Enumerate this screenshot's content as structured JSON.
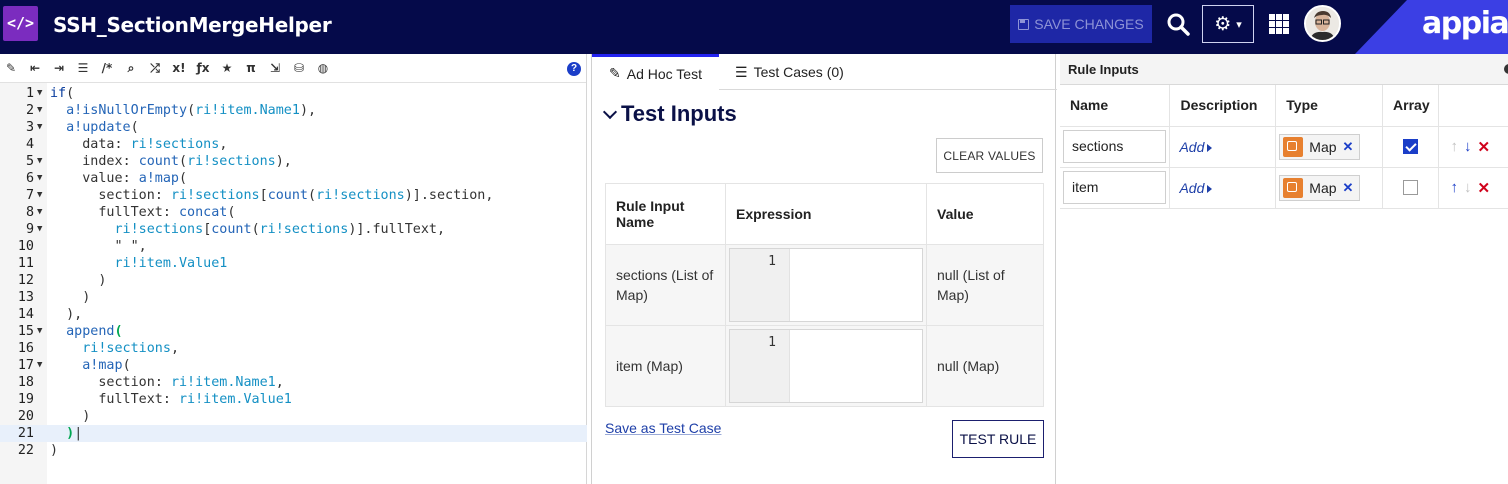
{
  "header": {
    "app_title": "SSH_SectionMergeHelper",
    "save_label": "SAVE CHANGES",
    "logo_text": "appian",
    "app_icon_glyph": "</>",
    "icons": [
      "code-icon",
      "save-icon",
      "search-icon",
      "gear-icon",
      "chevron-down-icon",
      "grid-icon",
      "avatar"
    ]
  },
  "editor": {
    "toolbar_icons": [
      "magic-wand-icon",
      "outdent-icon",
      "indent-icon",
      "list-icon",
      "comment-icon",
      "search-icon",
      "shuffle-icon",
      "x-bang-icon",
      "fx-icon",
      "star-icon",
      "pi-icon",
      "exit-icon",
      "database-icon",
      "globe-icon",
      "help-icon"
    ],
    "toolbar_glyphs": [
      "✎",
      "⇤",
      "⇥",
      "☰",
      "/*",
      "⌕",
      "⤮",
      "x!",
      "ƒx",
      "★",
      "π",
      "⇲",
      "⛁",
      "◍"
    ],
    "help_glyph": "?",
    "lines": [
      {
        "n": "1",
        "fold": "▼",
        "html": "<span class='k'>if</span><span class='p'>(</span>"
      },
      {
        "n": "2",
        "fold": "▼",
        "html": "  <span class='f'>a!isNullOrEmpty</span><span class='p'>(</span><span class='v'>ri!item.Name1</span><span class='p'>),</span>"
      },
      {
        "n": "3",
        "fold": "▼",
        "html": "  <span class='f'>a!update</span><span class='p'>(</span>"
      },
      {
        "n": "4",
        "fold": "",
        "html": "    <span class='s'>data</span><span class='p'>: </span><span class='v'>ri!sections</span><span class='p'>,</span>"
      },
      {
        "n": "5",
        "fold": "▼",
        "html": "    <span class='s'>index</span><span class='p'>: </span><span class='f'>count</span><span class='p'>(</span><span class='v'>ri!sections</span><span class='p'>),</span>"
      },
      {
        "n": "6",
        "fold": "▼",
        "html": "    <span class='s'>value</span><span class='p'>: </span><span class='f'>a!map</span><span class='p'>(</span>"
      },
      {
        "n": "7",
        "fold": "▼",
        "html": "      <span class='s'>section</span><span class='p'>: </span><span class='v'>ri!sections</span><span class='p'>[</span><span class='f'>count</span><span class='p'>(</span><span class='v'>ri!sections</span><span class='p'>)].section,</span>"
      },
      {
        "n": "8",
        "fold": "▼",
        "html": "      <span class='s'>fullText</span><span class='p'>: </span><span class='f'>concat</span><span class='p'>(</span>"
      },
      {
        "n": "9",
        "fold": "▼",
        "html": "        <span class='v'>ri!sections</span><span class='p'>[</span><span class='f'>count</span><span class='p'>(</span><span class='v'>ri!sections</span><span class='p'>)].fullText,</span>"
      },
      {
        "n": "10",
        "fold": "",
        "html": "        <span class='p'>\" \",</span>"
      },
      {
        "n": "11",
        "fold": "",
        "html": "        <span class='v'>ri!item.Value1</span>"
      },
      {
        "n": "12",
        "fold": "",
        "html": "      <span class='p'>)</span>"
      },
      {
        "n": "13",
        "fold": "",
        "html": "    <span class='p'>)</span>"
      },
      {
        "n": "14",
        "fold": "",
        "html": "  <span class='p'>),</span>"
      },
      {
        "n": "15",
        "fold": "▼",
        "html": "  <span class='f'>append</span><span class='cursor-bracket'>(</span>"
      },
      {
        "n": "16",
        "fold": "",
        "html": "    <span class='v'>ri!sections</span><span class='p'>,</span>"
      },
      {
        "n": "17",
        "fold": "▼",
        "html": "    <span class='f'>a!map</span><span class='p'>(</span>"
      },
      {
        "n": "18",
        "fold": "",
        "html": "      <span class='s'>section</span><span class='p'>: </span><span class='v'>ri!item.Name1</span><span class='p'>,</span>"
      },
      {
        "n": "19",
        "fold": "",
        "html": "      <span class='s'>fullText</span><span class='p'>: </span><span class='v'>ri!item.Value1</span>"
      },
      {
        "n": "20",
        "fold": "",
        "html": "    <span class='p'>)</span>"
      },
      {
        "n": "21",
        "fold": "",
        "html": "  <span class='cursor-bracket'>)</span><span class='p'>|</span>",
        "active": true
      },
      {
        "n": "22",
        "fold": "",
        "html": "<span class='p'>)</span>"
      }
    ]
  },
  "test_panel": {
    "tabs": [
      {
        "label": "Ad Hoc Test",
        "icon": "edit-icon",
        "active": true
      },
      {
        "label": "Test Cases (0)",
        "icon": "list-icon",
        "active": false
      }
    ],
    "section_title": "Test Inputs",
    "clear_label": "CLEAR VALUES",
    "columns": [
      "Rule Input Name",
      "Expression",
      "Value"
    ],
    "rows": [
      {
        "name": "sections (List of Map)",
        "line": "1",
        "value": "null (List of Map)"
      },
      {
        "name": "item (Map)",
        "line": "1",
        "value": "null (Map)"
      }
    ],
    "save_link": "Save as Test Case",
    "test_label": "TEST RULE"
  },
  "rule_inputs": {
    "title": "Rule Inputs",
    "columns": [
      "Name",
      "Description",
      "Type",
      "Array"
    ],
    "rows": [
      {
        "name": "sections",
        "description": "Add",
        "type": "Map",
        "array": true,
        "up_enabled": false,
        "down_enabled": true
      },
      {
        "name": "item",
        "description": "Add",
        "type": "Map",
        "array": false,
        "up_enabled": true,
        "down_enabled": false
      }
    ],
    "arrow_glyphs": {
      "up": "↑",
      "down": "↓",
      "delete": "✕",
      "remove": "✕"
    }
  }
}
